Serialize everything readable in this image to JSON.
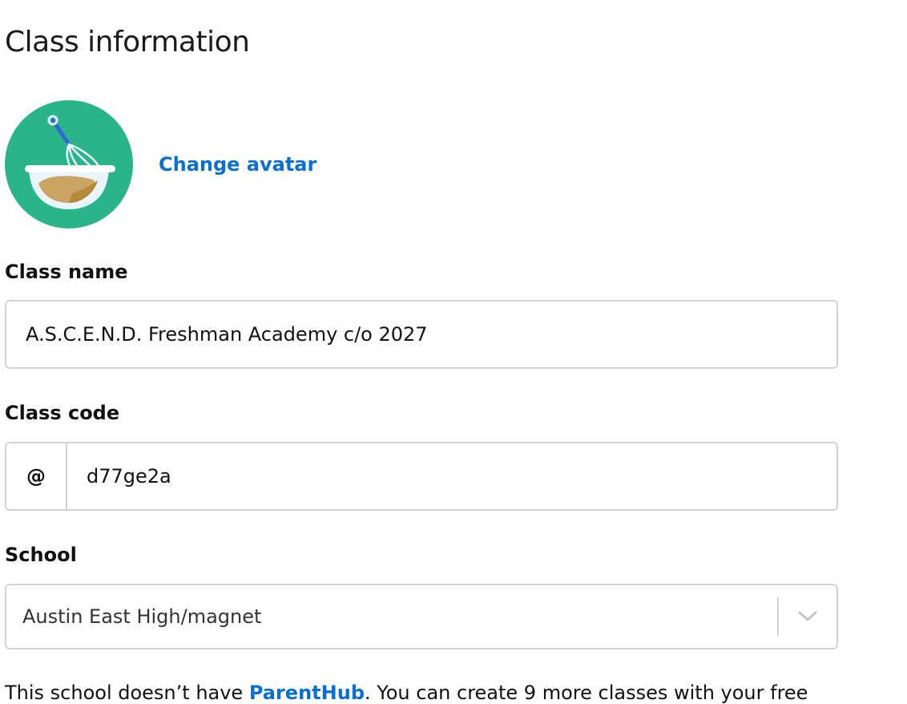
{
  "page": {
    "title": "Class information"
  },
  "avatar": {
    "icon": "mixing-bowl-whisk-icon",
    "background": "#2bb48a",
    "change_label": "Change avatar"
  },
  "class_name": {
    "label": "Class name",
    "value": "A.S.C.E.N.D. Freshman Academy c/o 2027"
  },
  "class_code": {
    "label": "Class code",
    "prefix": "@",
    "value": "d77ge2a"
  },
  "school": {
    "label": "School",
    "selected": "Austin East High/magnet"
  },
  "footer": {
    "text_before": "This school doesn’t have ",
    "link": "ParentHub",
    "text_after": ". You can create 9 more classes with your free"
  },
  "colors": {
    "link": "#0a6fd1",
    "border": "#d3d3d3"
  }
}
